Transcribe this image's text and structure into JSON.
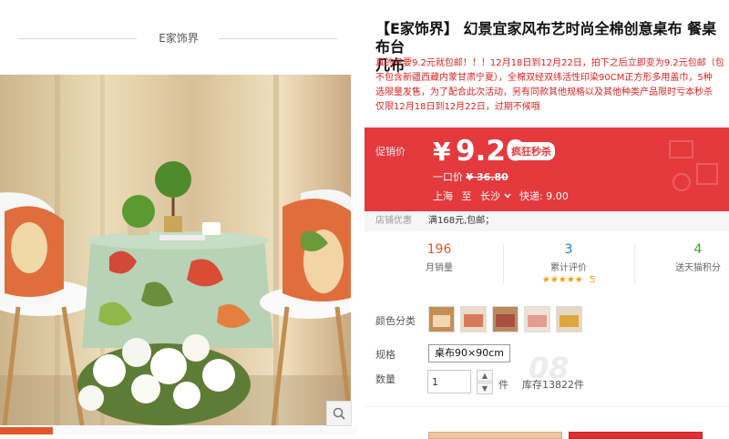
{
  "shop": {
    "name": "E家饰界"
  },
  "product": {
    "title_line1": "【E家饰界】 幻景宜家风布艺时尚全棉创意桌布 餐桌布台",
    "title_line2": "几布",
    "subtitle_lines": [
      "真的只要9.2元就包邮！！！12月18日到12月22日，拍下之后立即变为9.2元包邮（包",
      "不包含新疆西藏内蒙甘肃宁夏），全棉双经双纬活性印染90CM正方形多用盖巾，5种",
      "选限量发售，为了配合此次活动，另有同款其他规格以及其他种类产品限时亏本秒杀",
      "仅限12月18日到12月22日，过期不候哦"
    ]
  },
  "price": {
    "label": "促销价",
    "currency": "¥",
    "value": "9.20",
    "badge": "疯狂秒杀",
    "orig_label": "一口价",
    "orig_value": "¥ 36.80",
    "from": "上海",
    "to_word": "至",
    "to_city": "长沙",
    "shipping": "快递: 9.00"
  },
  "promotion": {
    "label": "店铺优惠",
    "value": "满168元,包邮；"
  },
  "stats": {
    "monthly_sales": "196",
    "monthly_label": "月销量",
    "reviews": "3",
    "reviews_label": "累计评价",
    "rating_stars": "★★★★★",
    "rating": "5",
    "points": "4",
    "points_label": "送天猫积分"
  },
  "color": {
    "label": "颜色分类",
    "swatch_colors": [
      "#c58f54",
      "#d9795b",
      "#a94f43",
      "#e49d8d",
      "#dda63f"
    ]
  },
  "spec": {
    "label": "规格",
    "value": "桌布90×90cm"
  },
  "quantity": {
    "label": "数量",
    "value": "1",
    "unit": "件",
    "stock": "库存13822件",
    "up": "▲",
    "down": "▼"
  },
  "watermark": "08",
  "colors": {
    "accent": "#e43a3d",
    "orange": "#e1572c",
    "green": "#3c9f2e",
    "blue": "#2a7ab7"
  }
}
